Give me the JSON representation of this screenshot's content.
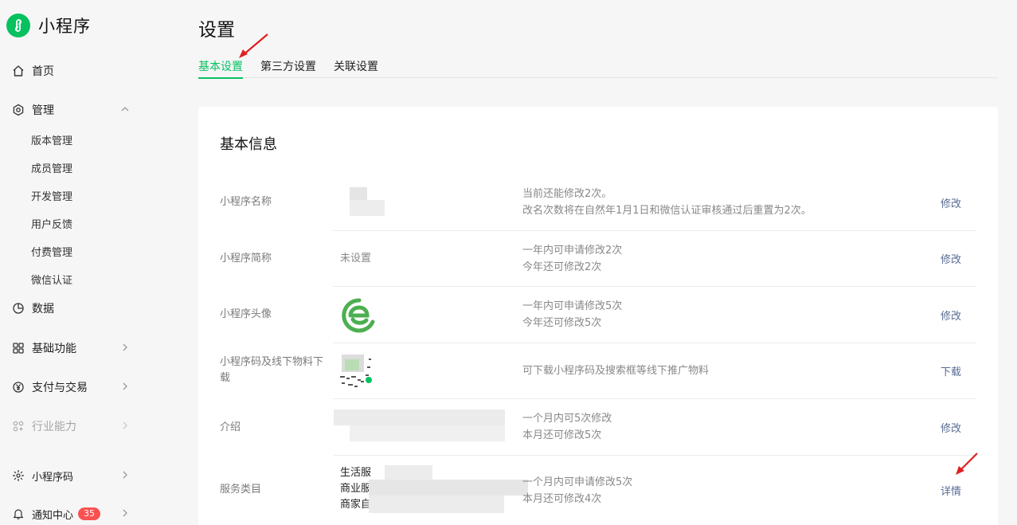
{
  "sidebar": {
    "brand": "小程序",
    "home": "首页",
    "manage": "管理",
    "manage_items": [
      "版本管理",
      "成员管理",
      "开发管理",
      "用户反馈",
      "付费管理",
      "微信认证"
    ],
    "data": "数据",
    "basic": "基础功能",
    "pay": "支付与交易",
    "industry": "行业能力",
    "qrcode": "小程序码",
    "notice": "通知中心",
    "notice_count": "35"
  },
  "page": {
    "title": "设置"
  },
  "tabs": [
    "基本设置",
    "第三方设置",
    "关联设置"
  ],
  "card": {
    "title": "基本信息",
    "rows": [
      {
        "label": "小程序名称",
        "value": "",
        "desc1": "当前还能修改2次。",
        "desc2": "改名次数将在自然年1月1日和微信认证审核通过后重置为2次。",
        "action": "修改"
      },
      {
        "label": "小程序简称",
        "value": "未设置",
        "desc1": "一年内可申请修改2次",
        "desc2": "今年还可修改2次",
        "action": "修改"
      },
      {
        "label": "小程序头像",
        "value": "",
        "desc1": "一年内可申请修改5次",
        "desc2": "今年还可修改5次",
        "action": "修改"
      },
      {
        "label": "小程序码及线下物料下载",
        "value": "",
        "desc1": "可下载小程序码及搜索框等线下推广物料",
        "desc2": "",
        "action": "下载"
      },
      {
        "label": "介绍",
        "value": "",
        "desc1": "一个月内可5次修改",
        "desc2": "本月还可修改5次",
        "action": "修改"
      },
      {
        "label": "服务类目",
        "value_lines": [
          "生活服",
          "商业服",
          "商家自"
        ],
        "desc1": "一个月内可申请修改5次",
        "desc2": "本月还可修改4次",
        "action": "详情"
      }
    ]
  },
  "colors": {
    "accent": "#07c160",
    "link": "#576b95",
    "badge": "#fa5151",
    "annotation": "#e02020"
  }
}
